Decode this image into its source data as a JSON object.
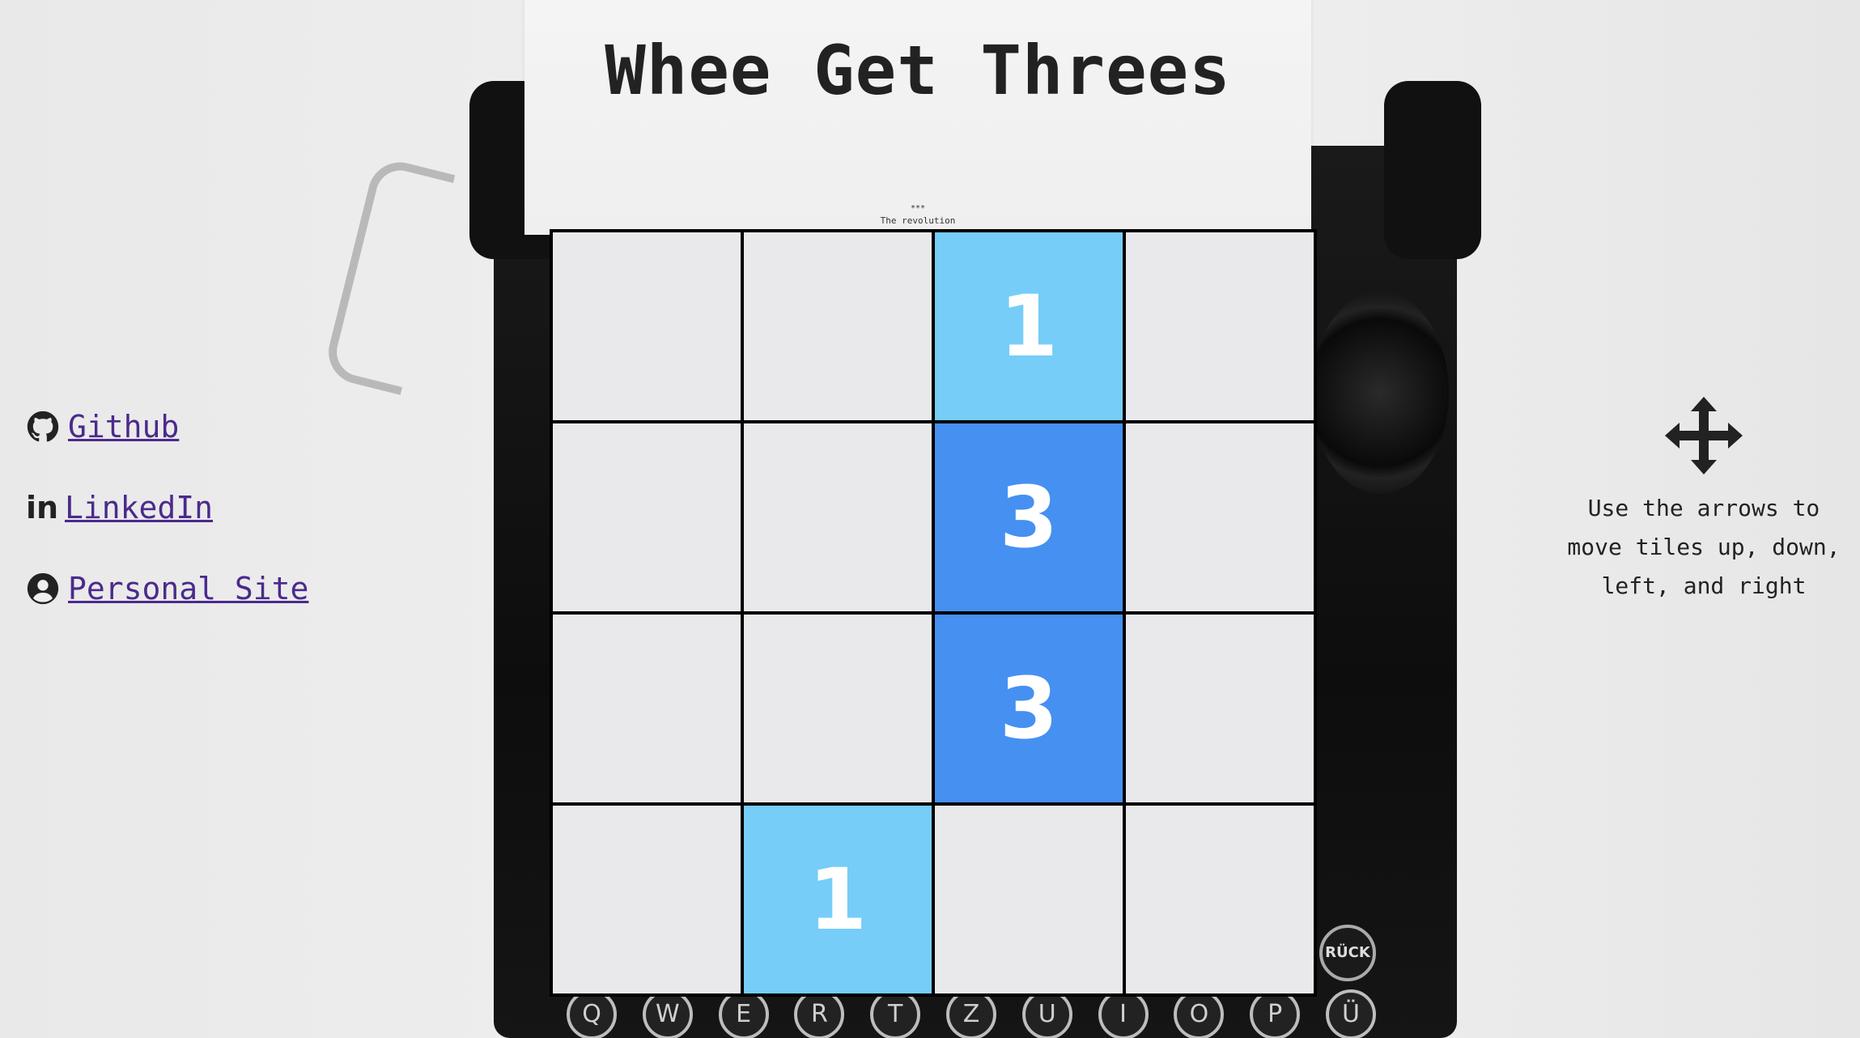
{
  "title": "Whee Get Threes",
  "paper": {
    "stars": "***",
    "caption": "The revolution"
  },
  "board": {
    "rows": [
      [
        null,
        null,
        1,
        null
      ],
      [
        null,
        null,
        3,
        null
      ],
      [
        null,
        null,
        3,
        null
      ],
      [
        null,
        1,
        null,
        null
      ]
    ],
    "colors": {
      "empty": "#e9e9ec",
      "tile_1": "#76cdf8",
      "tile_3": "#4690f1",
      "grid_lines": "#000000"
    }
  },
  "links": [
    {
      "icon": "github-icon",
      "label": "Github"
    },
    {
      "icon": "linkedin-icon",
      "label": "LinkedIn"
    },
    {
      "icon": "user-circle-icon",
      "label": "Personal Site"
    }
  ],
  "instructions": {
    "icon": "arrows-move-icon",
    "text": "Use the arrows to move tiles up, down, left, and right"
  },
  "typewriter": {
    "keys": [
      "Q",
      "W",
      "E",
      "R",
      "T",
      "Z",
      "U",
      "I",
      "O",
      "P",
      "Ü"
    ],
    "back_key": "RÜCK"
  },
  "link_color": "#4b2a8c"
}
